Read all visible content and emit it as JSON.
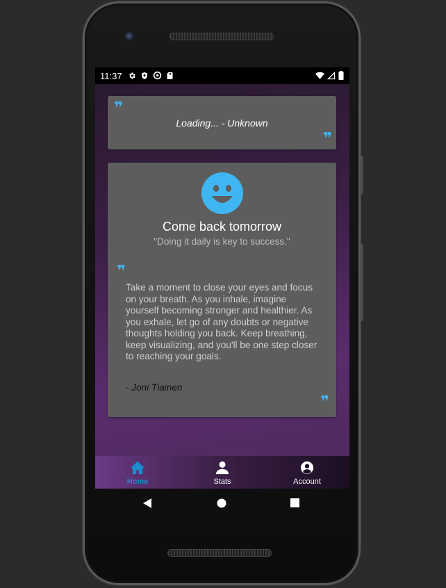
{
  "status_bar": {
    "time": "11:37",
    "left_icons": [
      "gear-icon",
      "shield-icon",
      "sync-icon",
      "sd-card-icon"
    ],
    "right_icons": [
      "wifi-icon",
      "signal-icon",
      "battery-icon"
    ]
  },
  "daily_quote": {
    "text": "Loading... - Unknown"
  },
  "status_card": {
    "icon": "smiley-icon",
    "title": "Come back tomorrow",
    "subtitle": "\"Doing it daily is key to success.\"",
    "body": "Take a moment to close your eyes and focus on your breath. As you inhale, imagine yourself becoming stronger and healthier. As you exhale, let go of any doubts or negative thoughts holding you back. Keep breathing, keep visualizing, and you'll be one step closer to reaching your goals.",
    "author": "- Joni Tiainen"
  },
  "bottom_nav": {
    "items": [
      {
        "label": "Home",
        "icon": "home-icon",
        "active": true
      },
      {
        "label": "Stats",
        "icon": "person-icon",
        "active": false
      },
      {
        "label": "Account",
        "icon": "account-circle-icon",
        "active": false
      }
    ]
  },
  "system_nav": [
    "back-icon",
    "home-circle-icon",
    "recents-icon"
  ],
  "colors": {
    "accent": "#3fb6f2",
    "active_nav": "#1a8cd0",
    "card_bg": "#5d5d5d",
    "app_bg_purple": "#5a2c6e"
  }
}
